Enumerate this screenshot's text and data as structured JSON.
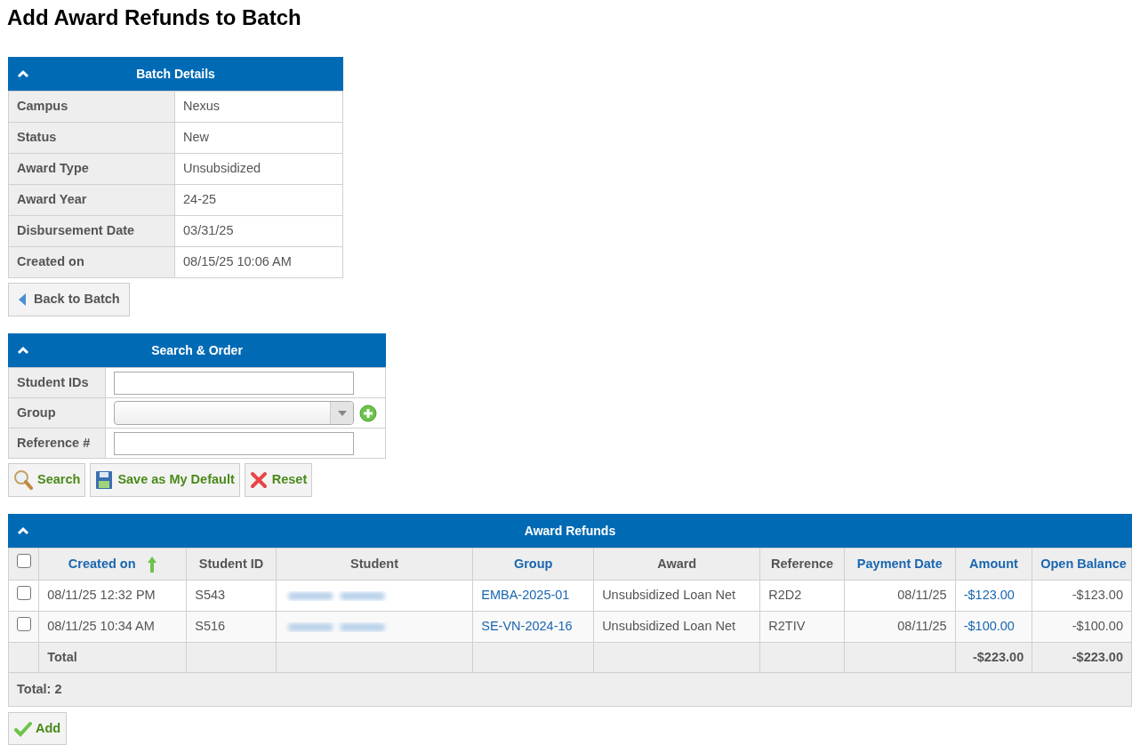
{
  "title": "Add Award Refunds to Batch",
  "batch_details": {
    "title": "Batch Details",
    "expanded": true,
    "rows": [
      {
        "label": "Campus",
        "value": "Nexus"
      },
      {
        "label": "Status",
        "value": "New"
      },
      {
        "label": "Award Type",
        "value": "Unsubsidized"
      },
      {
        "label": "Award Year",
        "value": "24-25"
      },
      {
        "label": "Disbursement Date",
        "value": "03/31/25"
      },
      {
        "label": "Created on",
        "value": "08/15/25 10:06 AM"
      }
    ]
  },
  "back_button": "Back to Batch",
  "search": {
    "title": "Search & Order",
    "expanded": true,
    "fields": [
      {
        "label": "Student IDs",
        "kind": "text"
      },
      {
        "label": "Group",
        "kind": "select"
      },
      {
        "label": "Reference #",
        "kind": "text"
      }
    ],
    "buttons": [
      {
        "label": "Search",
        "kind": "search"
      },
      {
        "label": "Save as My Default",
        "kind": "save"
      },
      {
        "label": "Reset",
        "kind": "reset"
      }
    ]
  },
  "refunds": {
    "title": "Award Refunds",
    "expanded": true,
    "select_all_checked": false,
    "columns": [
      {
        "label": "Created on",
        "link": true,
        "sorted": true
      },
      {
        "label": "Student ID",
        "link": false,
        "sorted": false
      },
      {
        "label": "Student",
        "link": false,
        "sorted": false
      },
      {
        "label": "Group",
        "link": true,
        "sorted": false
      },
      {
        "label": "Award",
        "link": false,
        "sorted": false
      },
      {
        "label": "Reference",
        "link": false,
        "sorted": false
      },
      {
        "label": "Payment Date",
        "link": true,
        "sorted": false
      },
      {
        "label": "Amount",
        "link": true,
        "sorted": false
      },
      {
        "label": "Open Balance",
        "link": true,
        "sorted": false
      }
    ],
    "rows": [
      {
        "checked": false,
        "created_on": "08/11/25 12:32 PM",
        "student_id": "S543",
        "group": "EMBA-2025-01",
        "award": "Unsubsidized Loan Net",
        "reference": "R2D2",
        "payment_date": "08/11/25",
        "amount": "-$123.00",
        "open_balance": "-$123.00"
      },
      {
        "checked": false,
        "created_on": "08/11/25 10:34 AM",
        "student_id": "S516",
        "group": "SE-VN-2024-16",
        "award": "Unsubsidized Loan Net",
        "reference": "R2TIV",
        "payment_date": "08/11/25",
        "amount": "-$100.00",
        "open_balance": "-$100.00"
      }
    ],
    "total_label": "Total",
    "total_amount": "-$223.00",
    "total_open_balance": "-$223.00",
    "count": "Total: 2"
  },
  "add_button": "Add"
}
